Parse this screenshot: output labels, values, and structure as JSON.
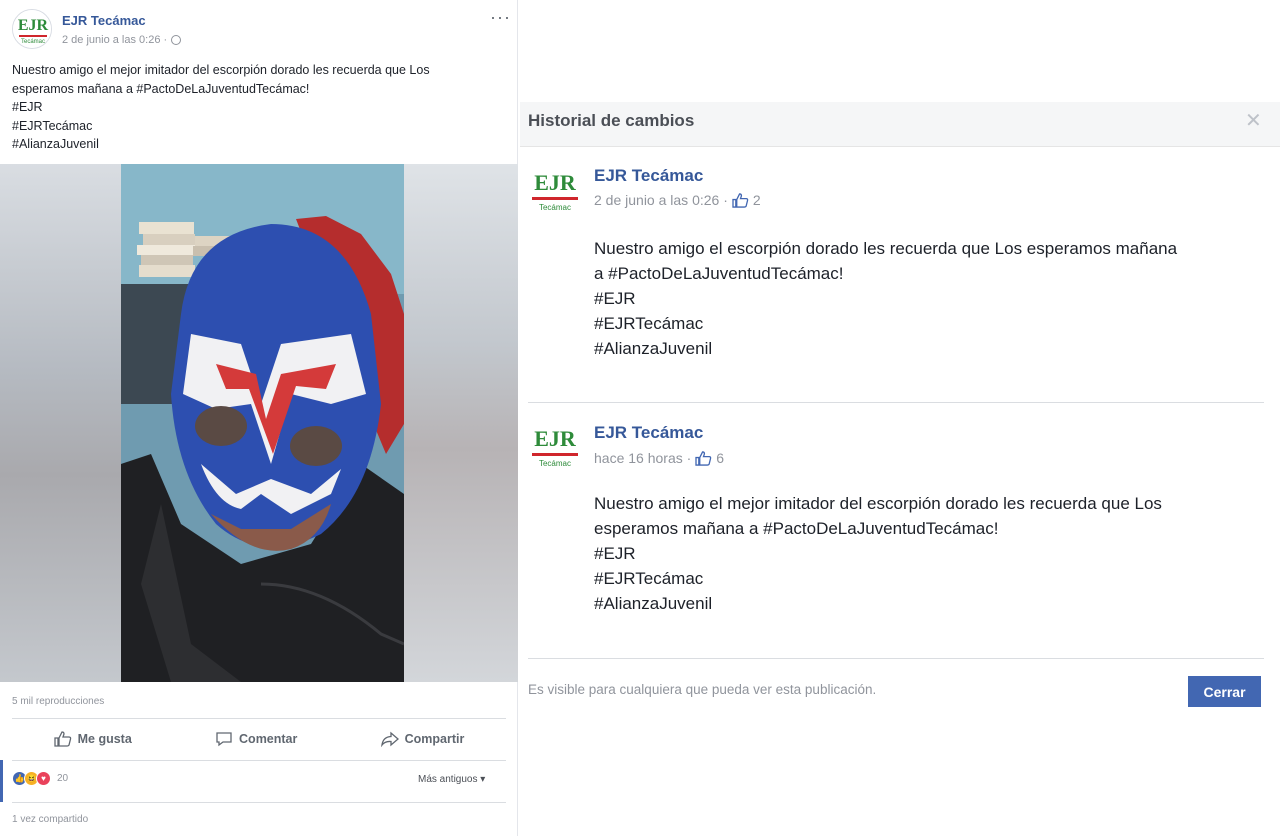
{
  "post": {
    "author": "EJR Tecámac",
    "timestamp": "2 de junio a las 0:26 ·",
    "menu": "···",
    "text_lines": [
      "Nuestro amigo el mejor imitador del escorpión dorado les recuerda que Los",
      "esperamos mañana a #PactoDeLaJuventudTecámac!",
      "#EJR",
      "#EJRTecámac",
      "#AlianzaJuvenil"
    ],
    "views": "5 mil reproducciones",
    "actions": {
      "like": "Me gusta",
      "comment": "Comentar",
      "share": "Compartir"
    },
    "reaction_count": "20",
    "sort_label": "Más antiguos ▾",
    "shared_count": "1 vez compartido",
    "logo_text": "EJR",
    "logo_sub": "Tecámac"
  },
  "modal": {
    "title": "Historial de cambios",
    "close_glyph": "✕",
    "entries": [
      {
        "author": "EJR Tecámac",
        "time": "2 de junio a las 0:26 ·",
        "likes": "2",
        "text_lines": [
          "Nuestro amigo el escorpión dorado les recuerda que Los esperamos mañana",
          "a #PactoDeLaJuventudTecámac!",
          "#EJR",
          "#EJRTecámac",
          "#AlianzaJuvenil"
        ]
      },
      {
        "author": "EJR Tecámac",
        "time": "hace 16 horas ·",
        "likes": "6",
        "text_lines": [
          "Nuestro amigo el mejor imitador del escorpión dorado les recuerda que Los",
          "esperamos mañana a #PactoDeLaJuventudTecámac!",
          "#EJR",
          "#EJRTecámac",
          "#AlianzaJuvenil"
        ]
      }
    ],
    "visibility_note": "Es visible para cualquiera que pueda ver esta publicación.",
    "close_button": "Cerrar"
  },
  "colors": {
    "brand_blue": "#4267b2",
    "link_blue": "#365899",
    "logo_green": "#2e8b3a",
    "logo_red": "#d0262c"
  }
}
